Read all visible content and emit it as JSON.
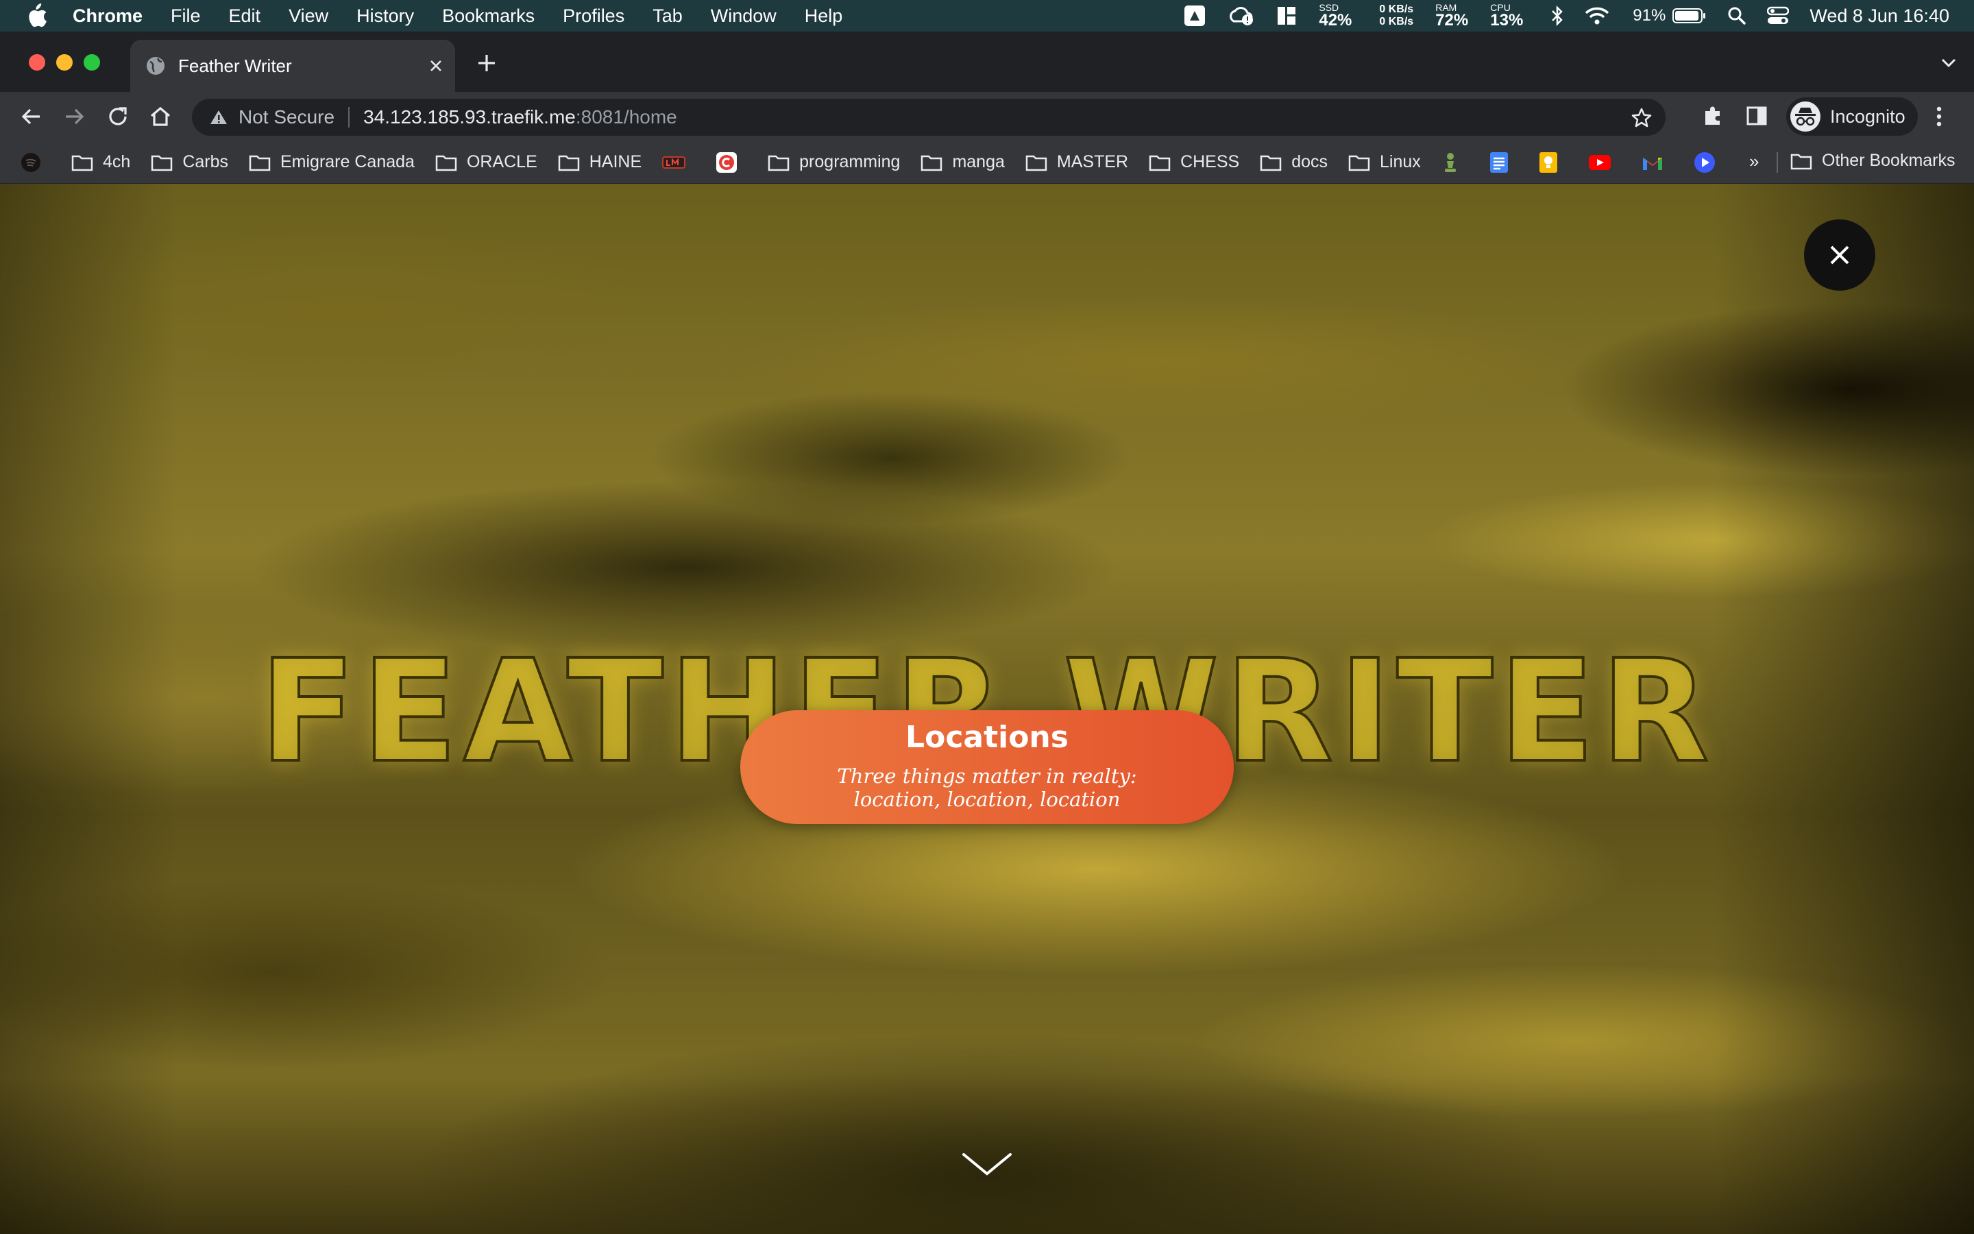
{
  "menubar": {
    "app_name": "Chrome",
    "menus": [
      "File",
      "Edit",
      "View",
      "History",
      "Bookmarks",
      "Profiles",
      "Tab",
      "Window",
      "Help"
    ],
    "ssd": {
      "label": "SSD",
      "value": "42%"
    },
    "net": {
      "up": "0 KB/s",
      "down": "0 KB/s"
    },
    "ram": {
      "label": "RAM",
      "value": "72%"
    },
    "cpu": {
      "label": "CPU",
      "value": "13%"
    },
    "battery": "91%",
    "clock": "Wed 8 Jun  16:40"
  },
  "browser": {
    "tab_title": "Feather Writer",
    "security_label": "Not Secure",
    "url_host": "34.123.185.93.traefik.me",
    "url_path": ":8081/home",
    "profile_label": "Incognito"
  },
  "bookmarks": {
    "folders_a": [
      "4ch",
      "Carbs",
      "Emigrare Canada",
      "ORACLE",
      "HAINE"
    ],
    "folders_b": [
      "programming",
      "manga",
      "MASTER",
      "CHESS",
      "docs",
      "Linux"
    ],
    "overflow": "»",
    "other": "Other Bookmarks"
  },
  "page": {
    "hero_title": "FEATHER WRITER",
    "card_heading": "Locations",
    "card_text": "Three things matter in realty: location, location, location"
  },
  "colors": {
    "menubar_bg": "#1e3a3f",
    "card_start": "#ec7a40",
    "card_end": "#e3522c",
    "hero_gold": "#e6c828"
  }
}
